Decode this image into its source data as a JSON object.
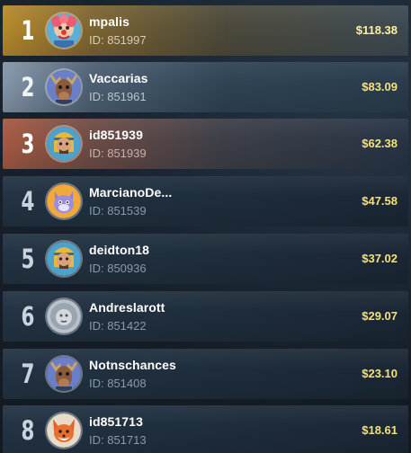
{
  "leaderboard": {
    "entries": [
      {
        "rank": "1",
        "name": "mpalis",
        "id": "ID: 851997",
        "amount": "$118.38",
        "tier": "gold",
        "avatar": "clown-avatar-icon"
      },
      {
        "rank": "2",
        "name": "Vaccarias",
        "id": "ID: 851961",
        "amount": "$83.09",
        "tier": "silver",
        "avatar": "moose-avatar-icon"
      },
      {
        "rank": "3",
        "name": "id851939",
        "id": "ID: 851939",
        "amount": "$62.38",
        "tier": "bronze",
        "avatar": "pharaoh-avatar-icon"
      },
      {
        "rank": "4",
        "name": "MarcianoDe...",
        "id": "ID: 851539",
        "amount": "$47.58",
        "tier": "normal",
        "avatar": "cat-avatar-icon"
      },
      {
        "rank": "5",
        "name": "deidton18",
        "id": "ID: 850936",
        "amount": "$37.02",
        "tier": "normal",
        "avatar": "pharaoh-avatar-icon"
      },
      {
        "rank": "6",
        "name": "Andreslarott",
        "id": "ID: 851422",
        "amount": "$29.07",
        "tier": "normal",
        "avatar": "lion-avatar-icon"
      },
      {
        "rank": "7",
        "name": "Notnschances",
        "id": "ID: 851408",
        "amount": "$23.10",
        "tier": "normal",
        "avatar": "moose-avatar-icon"
      },
      {
        "rank": "8",
        "name": "id851713",
        "id": "ID: 851713",
        "amount": "$18.61",
        "tier": "normal",
        "avatar": "fox-avatar-icon"
      }
    ]
  },
  "colors": {
    "gold": "#b68a2c",
    "silver": "#8496a8",
    "bronze": "#a65a42",
    "amount": "#f3e27a"
  }
}
